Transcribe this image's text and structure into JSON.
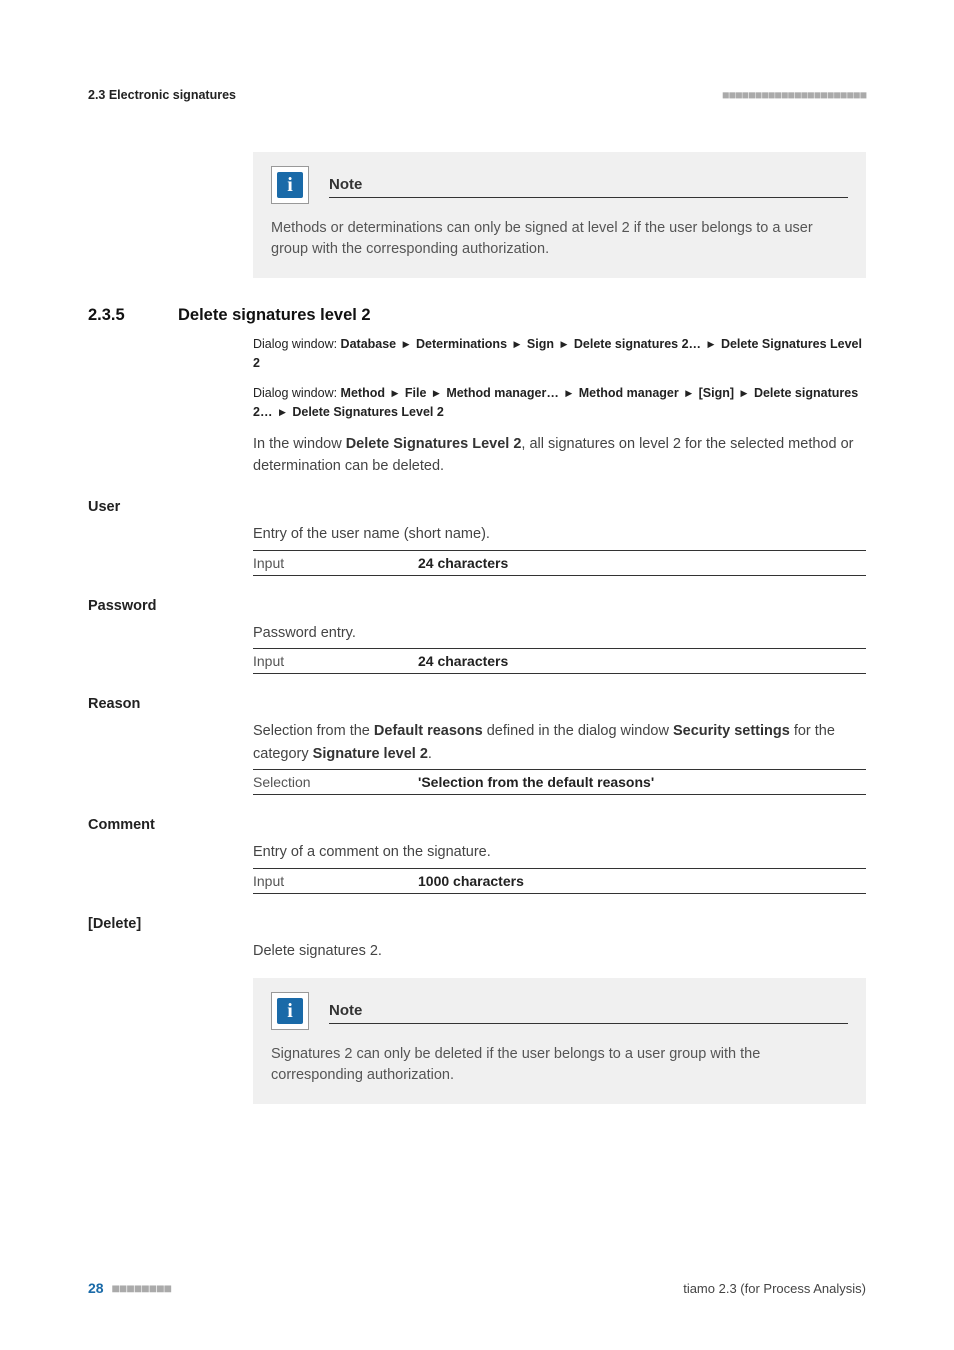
{
  "header": {
    "section_ref": "2.3 Electronic signatures"
  },
  "note1": {
    "label": "Note",
    "body": "Methods or determinations can only be signed at level 2 if the user belongs to a user group with the corresponding authorization."
  },
  "section": {
    "number": "2.3.5",
    "title": "Delete signatures level 2",
    "dialog1_pre": "Dialog window: ",
    "dialog1_b1": "Database",
    "dialog1_b2": "Determinations",
    "dialog1_b3": "Sign",
    "dialog1_b4": "Delete signatures 2…",
    "dialog1_b5": "Delete Signatures Level 2",
    "dialog2_pre": "Dialog window: ",
    "dialog2_b1": "Method",
    "dialog2_b2": "File",
    "dialog2_b3": "Method manager…",
    "dialog2_b4": "Method manager",
    "dialog2_b5": "[Sign]",
    "dialog2_b6": "Delete signatures 2…",
    "dialog2_b7": "Delete Signatures Level 2",
    "para_pre": "In the window ",
    "para_bold": "Delete Signatures Level 2",
    "para_post": ", all signatures on level 2 for the selected method or determination can be deleted."
  },
  "fields": {
    "user": {
      "label": "User",
      "desc": "Entry of the user name (short name).",
      "row_label": "Input",
      "row_value": "24 characters"
    },
    "password": {
      "label": "Password",
      "desc": "Password entry.",
      "row_label": "Input",
      "row_value": "24 characters"
    },
    "reason": {
      "label": "Reason",
      "desc_pre": "Selection from the ",
      "desc_b1": "Default reasons",
      "desc_mid": " defined in the dialog window ",
      "desc_b2": "Security settings",
      "desc_mid2": " for the category ",
      "desc_b3": "Signature level 2",
      "desc_post": ".",
      "row_label": "Selection",
      "row_value": "'Selection from the default reasons'"
    },
    "comment": {
      "label": "Comment",
      "desc": "Entry of a comment on the signature.",
      "row_label": "Input",
      "row_value": "1000 characters"
    },
    "delete": {
      "label": "[Delete]",
      "desc": "Delete signatures 2."
    }
  },
  "note2": {
    "label": "Note",
    "body": "Signatures 2 can only be deleted if the user belongs to a user group with the corresponding authorization."
  },
  "footer": {
    "page": "28",
    "product": "tiamo 2.3 (for Process Analysis)"
  }
}
